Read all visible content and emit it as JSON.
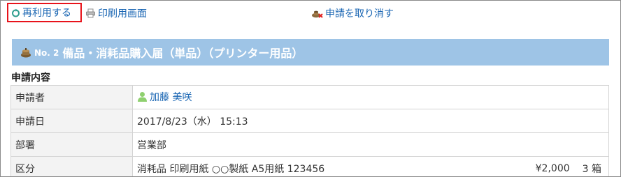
{
  "toolbar": {
    "reuse_label": "再利用する",
    "print_label": "印刷用画面",
    "cancel_label": "申請を取り消す"
  },
  "form": {
    "number": "No. 2",
    "title": "備品・消耗品購入届（単品）（プリンター用品）"
  },
  "section": {
    "label": "申請内容"
  },
  "details": {
    "applicant": {
      "label": "申請者",
      "value": "加藤 美咲"
    },
    "date": {
      "label": "申請日",
      "value": "2017/8/23（水） 15:13"
    },
    "department": {
      "label": "部署",
      "value": "営業部"
    },
    "category": {
      "label": "区分",
      "item": "消耗品 印刷用紙 ○○製紙 A5用紙 123456",
      "price": "¥2,000",
      "quantity": "3 箱"
    }
  },
  "colors": {
    "link": "#1a66b3",
    "title_bar": "#9ec4e6",
    "highlight_border": "#e8131b",
    "key_cell_bg": "#f3f3f3"
  },
  "icons": {
    "reuse": "recycle-icon",
    "print": "printer-icon",
    "cancel": "cancel-application-icon",
    "form": "form-pot-icon",
    "user": "user-icon"
  }
}
